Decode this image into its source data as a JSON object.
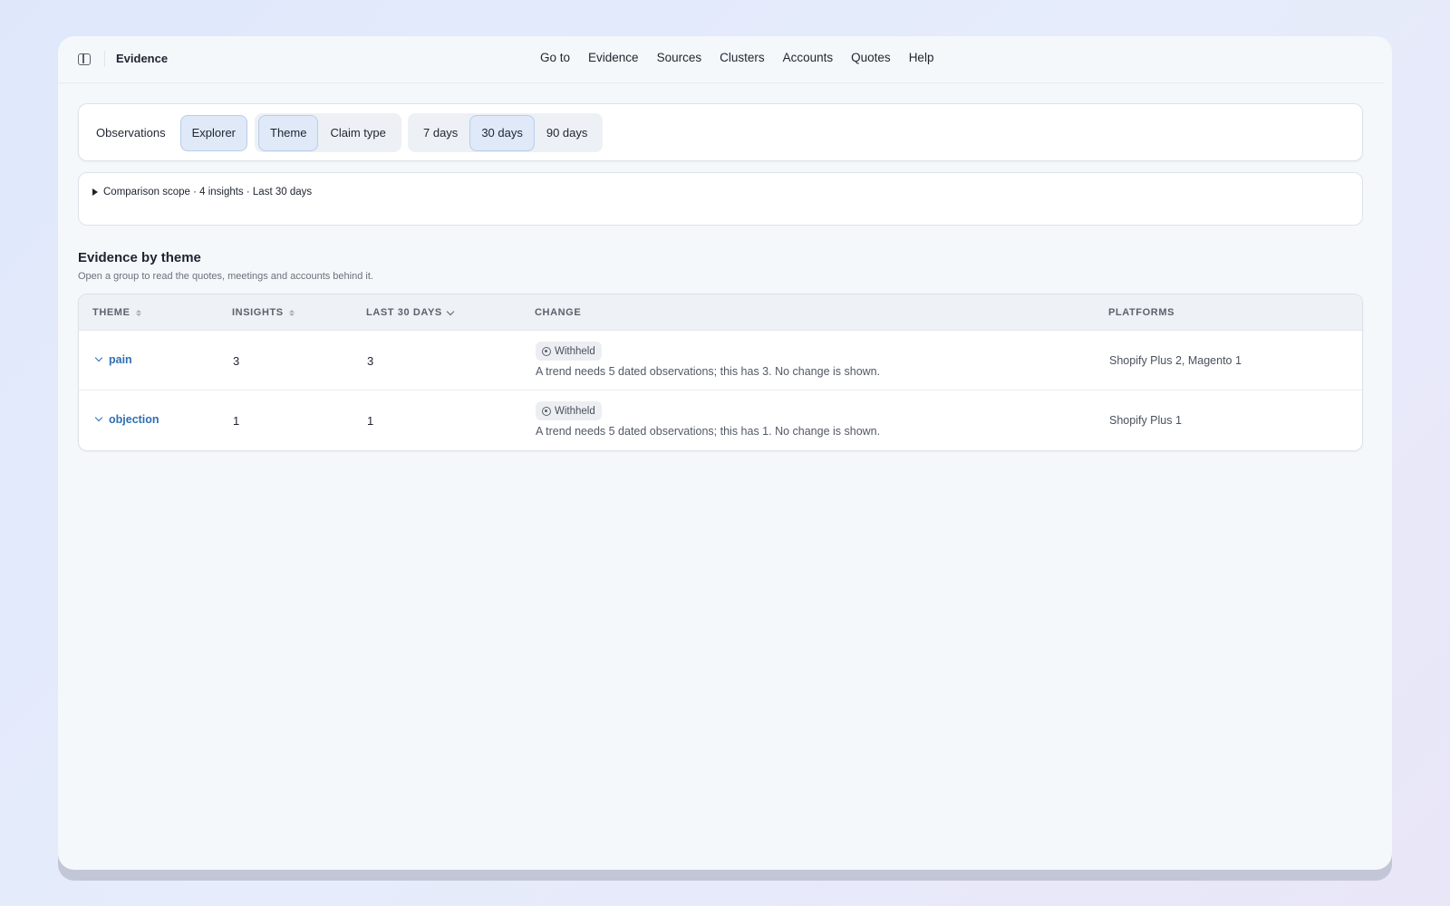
{
  "topbar": {
    "title": "Evidence",
    "nav": [
      "Go to",
      "Evidence",
      "Sources",
      "Clusters",
      "Accounts",
      "Quotes",
      "Help"
    ]
  },
  "controls": {
    "view": {
      "observations": "Observations",
      "explorer": "Explorer"
    },
    "group_by": {
      "theme": "Theme",
      "claim_type": "Claim type"
    },
    "range": {
      "d7": "7 days",
      "d30": "30 days",
      "d90": "90 days"
    },
    "active": {
      "view": "Explorer",
      "group_by": "Theme",
      "range": "30 days"
    }
  },
  "scope": {
    "summary": "Comparison scope · 4 insights · Last 30 days"
  },
  "section": {
    "title": "Evidence by theme",
    "subtitle": "Open a group to read the quotes, meetings and accounts behind it."
  },
  "table": {
    "headers": {
      "theme": "THEME",
      "insights": "INSIGHTS",
      "last": "LAST 30 DAYS",
      "change": "CHANGE",
      "platforms": "PLATFORMS"
    },
    "rows": [
      {
        "theme": "pain",
        "insights": "3",
        "last": "3",
        "badge": "Withheld",
        "note": "A trend needs 5 dated observations; this has 3. No change is shown.",
        "platforms": "Shopify Plus 2, Magento 1"
      },
      {
        "theme": "objection",
        "insights": "1",
        "last": "1",
        "badge": "Withheld",
        "note": "A trend needs 5 dated observations; this has 1. No change is shown.",
        "platforms": "Shopify Plus 1"
      }
    ]
  },
  "colors": {
    "accent": "#2f6fb0",
    "active_bg": "#dfe9f8",
    "active_border": "#b9cde8"
  }
}
